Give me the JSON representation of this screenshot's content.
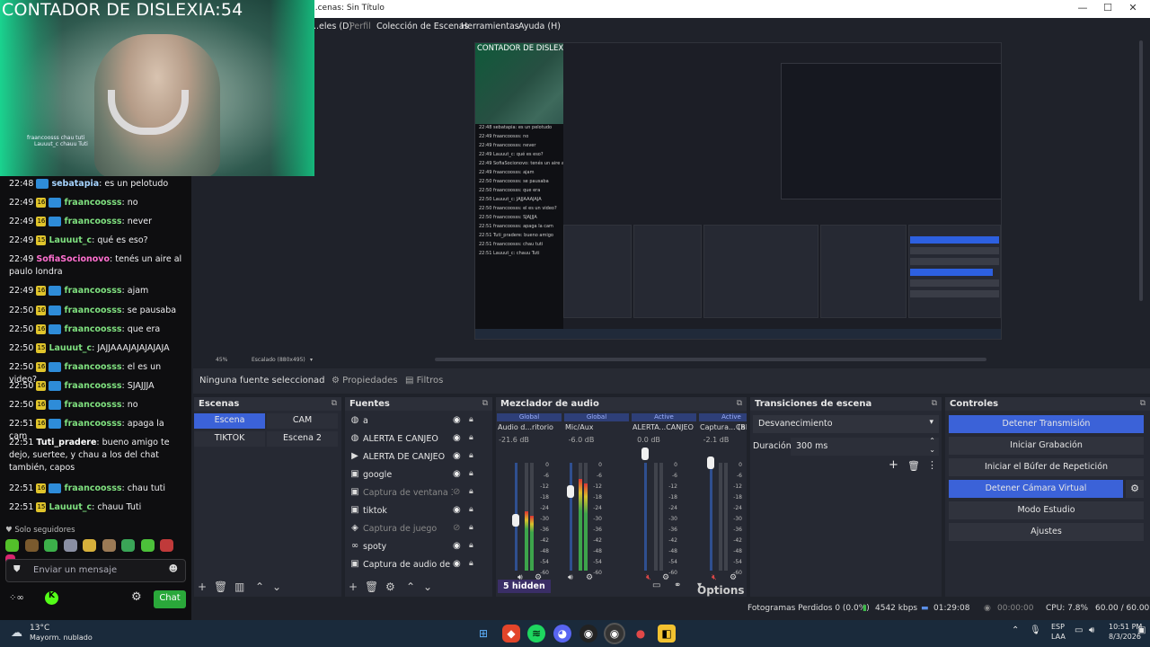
{
  "window": {
    "title": "...cenas: Sin Título",
    "controls": [
      "—",
      "☐",
      "✕"
    ]
  },
  "menu": [
    {
      "label": "...eles (D)",
      "disabled": false
    },
    {
      "label": "Perfil",
      "disabled": true
    },
    {
      "label": "Colección de Escenas",
      "disabled": false
    },
    {
      "label": "Herramientas",
      "disabled": false
    },
    {
      "label": "Ayuda (H)",
      "disabled": false
    }
  ],
  "overlay": {
    "title": "CONTADOR DE DISLEXIA:54",
    "cam_chat": [
      "fraancoosss chau tuti",
      "Lauuut_c chauu Tuti"
    ]
  },
  "preview": {
    "inner_title": "CONTADOR DE DISLEXIA:54",
    "zoom": "45%",
    "scale_label": "Escalado (880x495)"
  },
  "source_bar": {
    "no_selection": "Ninguna fuente seleccionad",
    "properties": "Propiedades",
    "filters": "Filtros"
  },
  "scenes": {
    "title": "Escenas",
    "items": [
      {
        "label": "Escena",
        "active": true
      },
      {
        "label": "CAM",
        "active": false
      },
      {
        "label": "TIKTOK",
        "active": false
      },
      {
        "label": "Escena 2",
        "active": false
      }
    ]
  },
  "sources": {
    "title": "Fuentes",
    "items": [
      {
        "icon": "globe",
        "label": "a",
        "hidden": false
      },
      {
        "icon": "globe",
        "label": "ALERTA E CANJEO",
        "hidden": false
      },
      {
        "icon": "play",
        "label": "ALERTA DE CANJEO",
        "hidden": false
      },
      {
        "icon": "window",
        "label": "google",
        "hidden": false
      },
      {
        "icon": "window",
        "label": "Captura de ventana 3",
        "hidden": true
      },
      {
        "icon": "window",
        "label": "tiktok",
        "hidden": false
      },
      {
        "icon": "gamepad",
        "label": "Captura de juego",
        "hidden": true
      },
      {
        "icon": "link",
        "label": "spoty",
        "hidden": false
      },
      {
        "icon": "window",
        "label": "Captura de audio de apli",
        "hidden": false
      }
    ]
  },
  "mixer": {
    "title": "Mezclador de audio",
    "channels": [
      {
        "tag": "Global",
        "name": "Audio d...ritorio",
        "db": "-21.6 dB",
        "level": 0.55,
        "muted": false
      },
      {
        "tag": "Global",
        "name": "Mic/Aux",
        "db": "-6.0 dB",
        "level": 0.85,
        "muted": false
      },
      {
        "tag": "Active",
        "name": "ALERTA...CANJEO",
        "db": "0.0 dB",
        "level": 0.0,
        "muted": true
      },
      {
        "tag": "Active",
        "name": "Captura... (BETA)",
        "db": "-2.1 dB",
        "level": 0.0,
        "muted": true
      },
      {
        "tag": "",
        "name": "Ca",
        "db": "",
        "level": 0.0,
        "muted": false
      }
    ],
    "ticks": [
      "0",
      "-6",
      "-12",
      "-18",
      "-24",
      "-30",
      "-36",
      "-42",
      "-48",
      "-54",
      "-60"
    ],
    "hidden_label": "5 hidden",
    "options_label": "Options"
  },
  "transitions": {
    "title": "Transiciones de escena",
    "selected": "Desvanecimiento",
    "duration_label": "Duración",
    "duration_value": "300 ms"
  },
  "controls": {
    "title": "Controles",
    "buttons": [
      {
        "label": "Detener Transmisión",
        "active": true
      },
      {
        "label": "Iniciar Grabación",
        "active": false
      },
      {
        "label": "Iniciar el Búfer de Repetición",
        "active": false
      },
      {
        "label": "Detener Cámara Virtual",
        "active": true
      },
      {
        "label": "Modo Estudio",
        "active": false
      },
      {
        "label": "Ajustes",
        "active": false
      }
    ]
  },
  "status": {
    "dropped": "Fotogramas Perdidos 0 (0.0%)",
    "bitrate": "4542 kbps",
    "stream_time": "01:29:08",
    "rec_time": "00:00:00",
    "cpu": "CPU: 7.8%",
    "fps": "60.00 / 60.00 FPS"
  },
  "chat": {
    "messages": [
      {
        "time": "22:48",
        "user": "sebatapia",
        "color": "#a6d4ff",
        "text": "es un pelotudo",
        "sub": "",
        "tw": true
      },
      {
        "time": "22:49",
        "user": "fraancoosss",
        "color": "#7fe07f",
        "text": "no",
        "sub": "16",
        "tw": true
      },
      {
        "time": "22:49",
        "user": "fraancoosss",
        "color": "#7fe07f",
        "text": "never",
        "sub": "16",
        "tw": true
      },
      {
        "time": "22:49",
        "user": "Lauuut_c",
        "color": "#7fe07f",
        "text": "qué es eso?",
        "sub": "15",
        "tw": false
      },
      {
        "time": "22:49",
        "user": "SofiaSocionovo",
        "color": "#ff6fcf",
        "text": "tenés un aire al paulo londra",
        "sub": "",
        "tw": false
      },
      {
        "time": "22:49",
        "user": "fraancoosss",
        "color": "#7fe07f",
        "text": "ajam",
        "sub": "16",
        "tw": true
      },
      {
        "time": "22:50",
        "user": "fraancoosss",
        "color": "#7fe07f",
        "text": "se pausaba",
        "sub": "16",
        "tw": true
      },
      {
        "time": "22:50",
        "user": "fraancoosss",
        "color": "#7fe07f",
        "text": "que era",
        "sub": "16",
        "tw": true
      },
      {
        "time": "22:50",
        "user": "Lauuut_c",
        "color": "#7fe07f",
        "text": "JAJJAAAJAJAJAJAJA",
        "sub": "15",
        "tw": false
      },
      {
        "time": "22:50",
        "user": "fraancoosss",
        "color": "#7fe07f",
        "text": "el es un video?",
        "sub": "16",
        "tw": true
      },
      {
        "time": "22:50",
        "user": "fraancoosss",
        "color": "#7fe07f",
        "text": "SJAJJJA",
        "sub": "16",
        "tw": true
      },
      {
        "time": "22:50",
        "user": "fraancoosss",
        "color": "#7fe07f",
        "text": "no",
        "sub": "16",
        "tw": true
      },
      {
        "time": "22:51",
        "user": "fraancoosss",
        "color": "#7fe07f",
        "text": "apaga la cam",
        "sub": "16",
        "tw": true
      },
      {
        "time": "22:51",
        "user": "Tuti_pradere",
        "color": "#ffffff",
        "text": "bueno amigo te dejo, suertee, y chau a los del chat también, capos",
        "sub": "",
        "tw": false
      },
      {
        "time": "22:51",
        "user": "fraancoosss",
        "color": "#7fe07f",
        "text": "chau tuti",
        "sub": "16",
        "tw": true
      },
      {
        "time": "22:51",
        "user": "Lauuut_c",
        "color": "#7fe07f",
        "text": "chauu Tuti",
        "sub": "15",
        "tw": false
      }
    ],
    "followers_only": "Solo seguidores",
    "placeholder": "Enviar un mensaje",
    "chat_button": "Chat"
  },
  "taskbar": {
    "weather_temp": "13°C",
    "weather_desc": "Mayorm. nublado",
    "lang": "ESP",
    "lang2": "LAA",
    "time": "10:51 PM",
    "date": "8/3/2026"
  },
  "colors": {
    "accent": "#3b62d8",
    "kick_green": "#53fc18",
    "chat_green": "#2aa83a"
  }
}
